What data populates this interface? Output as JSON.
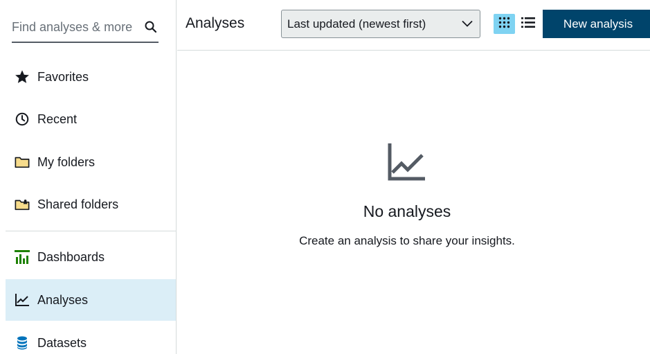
{
  "search": {
    "placeholder": "Find analyses & more",
    "value": ""
  },
  "sidebar": {
    "items": [
      {
        "label": "Favorites",
        "icon": "star-icon"
      },
      {
        "label": "Recent",
        "icon": "clock-icon"
      },
      {
        "label": "My folders",
        "icon": "folder-icon"
      },
      {
        "label": "Shared folders",
        "icon": "shared-folder-icon"
      },
      {
        "label": "Dashboards",
        "icon": "dashboard-icon"
      },
      {
        "label": "Analyses",
        "icon": "analysis-icon",
        "active": true
      },
      {
        "label": "Datasets",
        "icon": "database-icon"
      }
    ]
  },
  "header": {
    "title": "Analyses",
    "sort_value": "Last updated (newest first)",
    "new_button": "New analysis"
  },
  "empty_state": {
    "heading": "No analyses",
    "message": "Create an analysis to share your insights."
  },
  "colors": {
    "primary_button": "#00446b",
    "active_nav": "#dbeef7",
    "active_view_toggle": "#7fd3f2",
    "folder_fill": "#f7dc8c",
    "dashboard_green": "#1d8102",
    "dataset_blue": "#0073bb"
  }
}
